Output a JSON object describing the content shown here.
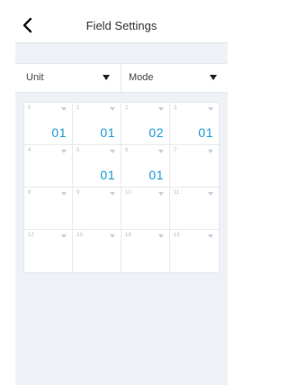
{
  "header": {
    "title": "Field Settings"
  },
  "selectors": {
    "unit_label": "Unit",
    "mode_label": "Mode"
  },
  "colors": {
    "accent": "#1a9ad6",
    "background": "#eef1f5"
  },
  "icons": {
    "back": "chevron-left-icon",
    "dropdown": "caret-down-icon"
  },
  "grid": {
    "cells": [
      {
        "index": "0",
        "value": "01"
      },
      {
        "index": "1",
        "value": "01"
      },
      {
        "index": "2",
        "value": "02"
      },
      {
        "index": "3",
        "value": "01"
      },
      {
        "index": "4",
        "value": ""
      },
      {
        "index": "5",
        "value": "01"
      },
      {
        "index": "6",
        "value": "01"
      },
      {
        "index": "7",
        "value": ""
      },
      {
        "index": "8",
        "value": ""
      },
      {
        "index": "9",
        "value": ""
      },
      {
        "index": "10",
        "value": ""
      },
      {
        "index": "11",
        "value": ""
      },
      {
        "index": "12",
        "value": ""
      },
      {
        "index": "13",
        "value": ""
      },
      {
        "index": "14",
        "value": ""
      },
      {
        "index": "15",
        "value": ""
      }
    ]
  }
}
